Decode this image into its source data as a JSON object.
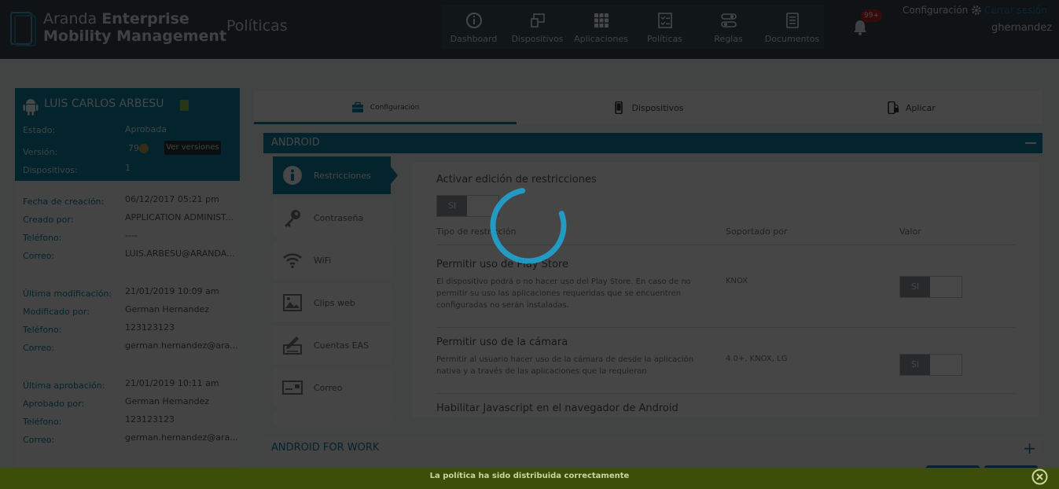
{
  "header": {
    "brand_light": "Aranda ",
    "brand_bold_1": "Enterprise",
    "brand_bold_2": "Mobility Management",
    "page_title": "Políticas",
    "nav": [
      {
        "label": "Dashboard",
        "icon": "info-circle-icon"
      },
      {
        "label": "Dispositivos",
        "icon": "devices-icon"
      },
      {
        "label": "Aplicaciones",
        "icon": "grid-icon"
      },
      {
        "label": "Políticas",
        "icon": "checklist-icon"
      },
      {
        "label": "Reglas",
        "icon": "rules-icon"
      },
      {
        "label": "Documentos",
        "icon": "document-icon"
      }
    ],
    "notifications_badge": "99+",
    "config_label": "Configuración",
    "logout_label": "Cerrar sesión",
    "username": "ghernandez"
  },
  "profile": {
    "name": "LUIS CARLOS ARBESU",
    "estado_label": "Estado:",
    "estado_value": "Aprobada",
    "version_label": "Versión:",
    "version_value": "79",
    "versions_button": "Ver versiones",
    "dispositivos_label": "Dispositivos:",
    "dispositivos_value": "1"
  },
  "info": {
    "creacion": {
      "fecha_label": "Fecha de creación:",
      "fecha_value": "06/12/2017 05:21 pm",
      "por_label": "Creado por:",
      "por_value": "APPLICATION ADMINIST...",
      "tel_label": "Teléfono:",
      "tel_value": "----",
      "correo_label": "Correo:",
      "correo_value": "LUIS.ARBESU@ARANDA..."
    },
    "modificacion": {
      "fecha_label": "Última modificación:",
      "fecha_value": "21/01/2019 10:09 am",
      "por_label": "Modificado por:",
      "por_value": "German Hernandez",
      "tel_label": "Teléfono:",
      "tel_value": "123123123",
      "correo_label": "Correo:",
      "correo_value": "german.hernandez@ara..."
    },
    "aprobacion": {
      "fecha_label": "Última aprobación:",
      "fecha_value": "21/01/2019 10:11 am",
      "por_label": "Aprobado por:",
      "por_value": "German Hernandez",
      "tel_label": "Teléfono:",
      "tel_value": "123123123",
      "correo_label": "Correo:",
      "correo_value": "german.hernandez@ara..."
    }
  },
  "tabs": [
    {
      "label": "Configuración",
      "icon": "briefcase-icon",
      "active": true
    },
    {
      "label": "Dispositivos",
      "icon": "phone-icon",
      "active": false
    },
    {
      "label": "Aplicar",
      "icon": "phone-lock-icon",
      "active": false
    }
  ],
  "android_section": {
    "title": "ANDROID",
    "side_items": [
      {
        "label": "Restricciones",
        "icon": "alert-circle-icon",
        "active": true
      },
      {
        "label": "Contraseña",
        "icon": "key-icon",
        "active": false
      },
      {
        "label": "WiFi",
        "icon": "wifi-icon",
        "active": false
      },
      {
        "label": "Clips web",
        "icon": "image-icon",
        "active": false
      },
      {
        "label": "Cuentas EAS",
        "icon": "signature-icon",
        "active": false
      },
      {
        "label": "Correo",
        "icon": "mail-card-icon",
        "active": false
      }
    ],
    "activate_title": "Activar edición de restricciones",
    "toggle_label": "SI",
    "col_type": "Tipo de restricción",
    "col_supported": "Soportado por",
    "col_value": "Valor",
    "restrictions": [
      {
        "title": "Permitir uso de Play Store",
        "desc": "El dispositivo podrá o no hacer uso del Play Store. En caso de no permitir su uso las aplicaciones requeridas que se encuentren configuradas no serán instaladas.",
        "supported": "KNOX",
        "value": "SI"
      },
      {
        "title": "Permitir uso de la cámara",
        "desc": "Permitir al usuario hacer uso de la cámara de desde la aplicación nativa y a través de las aplicaciones que la requieran",
        "supported": "4.0+, KNOX, LG",
        "value": "SI"
      },
      {
        "title": "Habilitar Javascript en el navegador de Android"
      }
    ]
  },
  "android_work_section": {
    "title": "ANDROID FOR WORK"
  },
  "toast": {
    "message": "La política ha sido distribuida correctamente"
  },
  "colors": {
    "accent": "#0d7fa0",
    "header": "#37474f",
    "toast": "#3c4e08",
    "spinner": "#1ea8d8"
  }
}
